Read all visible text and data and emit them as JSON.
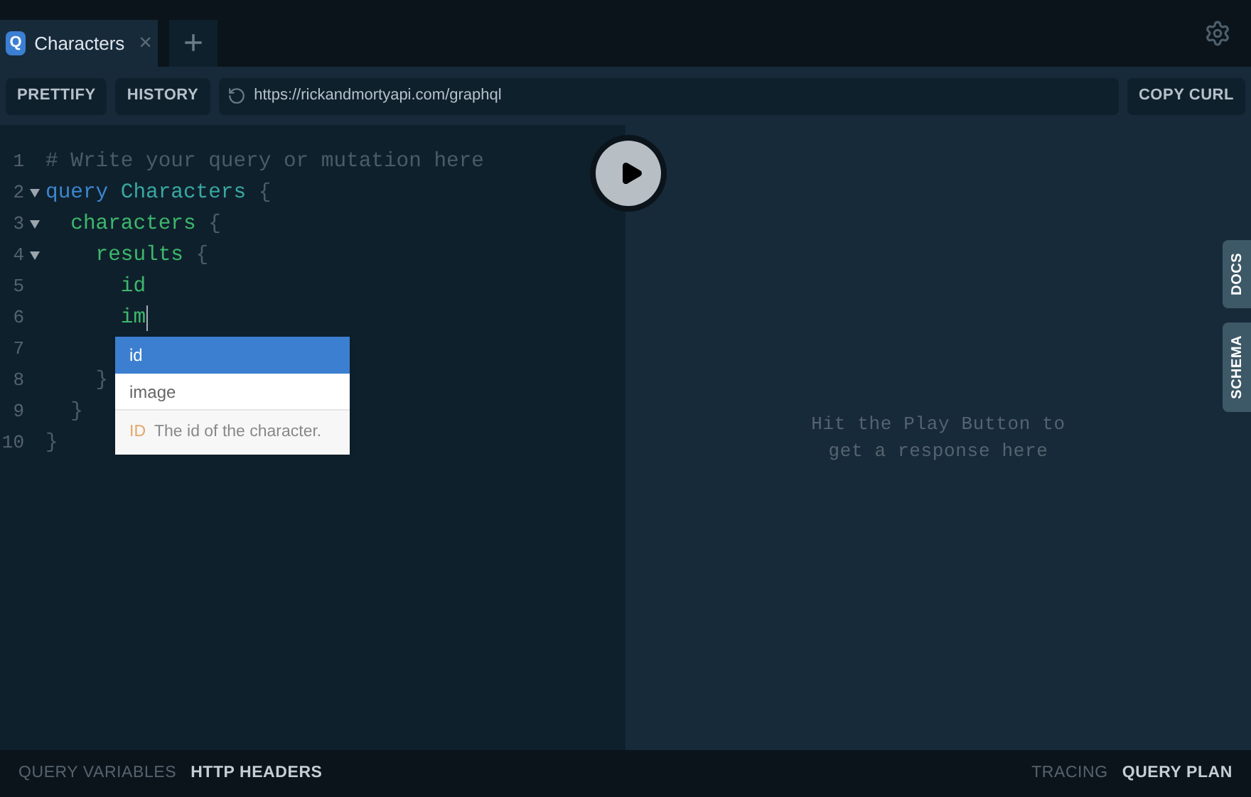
{
  "tabs": [
    {
      "badge": "Q",
      "label": "Characters",
      "close": "×",
      "selected": true
    }
  ],
  "new_tab": "+",
  "toolbar": {
    "buttons": [
      "PRETTIFY",
      "HISTORY"
    ],
    "url": "https://rickandmortyapi.com/graphql",
    "copy": "COPY CURL"
  },
  "editor": {
    "lines": [
      {
        "number": "1",
        "fold": false,
        "tokens": [
          {
            "text": "# Write your query or mutation here",
            "kind": "comment"
          }
        ]
      },
      {
        "number": "2",
        "fold": true,
        "tokens": [
          {
            "text": "query",
            "kind": "keyword"
          },
          {
            "text": " Characters",
            "kind": "def"
          },
          {
            "text": " {",
            "kind": "punct"
          }
        ]
      },
      {
        "number": "3",
        "fold": true,
        "tokens": [
          {
            "text": "  characters",
            "kind": "field"
          },
          {
            "text": " {",
            "kind": "punct"
          }
        ]
      },
      {
        "number": "4",
        "fold": true,
        "tokens": [
          {
            "text": "    results",
            "kind": "field"
          },
          {
            "text": " {",
            "kind": "punct"
          }
        ]
      },
      {
        "number": "5",
        "fold": false,
        "tokens": [
          {
            "text": "      id",
            "kind": "field"
          }
        ]
      },
      {
        "number": "6",
        "fold": false,
        "cursor": true,
        "tokens": [
          {
            "text": "      im",
            "kind": "field"
          }
        ]
      },
      {
        "number": "7",
        "fold": false
      },
      {
        "number": "8",
        "fold": false,
        "tokens": [
          {
            "text": "    }",
            "kind": "punct"
          }
        ]
      },
      {
        "number": "9",
        "fold": false,
        "tokens": [
          {
            "text": "  }",
            "kind": "punct"
          }
        ]
      },
      {
        "number": "10",
        "fold": false,
        "tokens": [
          {
            "text": "}",
            "kind": "punct"
          }
        ]
      }
    ],
    "autocomplete": {
      "items": [
        {
          "label": "id",
          "selected": true
        },
        {
          "label": "image",
          "selected": false
        }
      ],
      "type": "ID",
      "description": "The id of the character."
    }
  },
  "result": {
    "hint": "Hit the Play Button to get a response here"
  },
  "side_tabs": [
    "DOCS",
    "SCHEMA"
  ],
  "footer": {
    "left": [
      {
        "label": "QUERY VARIABLES",
        "selected": false
      },
      {
        "label": "HTTP HEADERS",
        "selected": true
      }
    ],
    "right": [
      {
        "label": "TRACING",
        "selected": false
      },
      {
        "label": "QUERY PLAN",
        "selected": true
      }
    ]
  }
}
